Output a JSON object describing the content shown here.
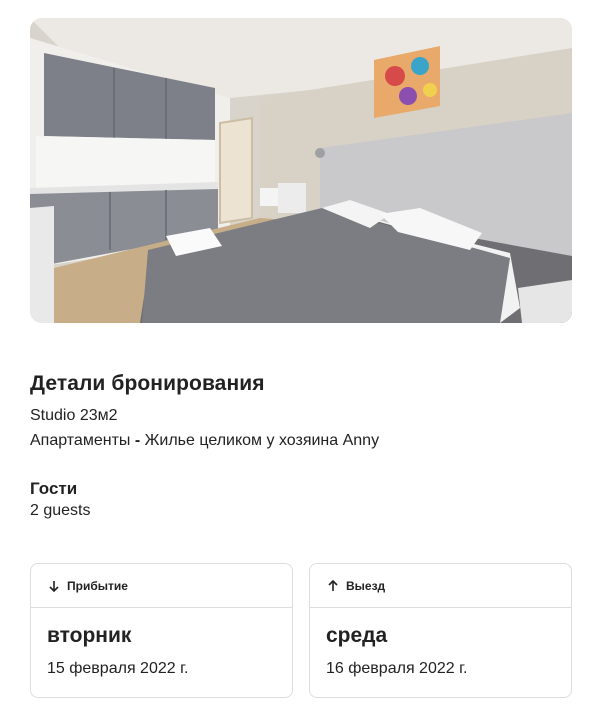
{
  "listing": {
    "photo_icon": "bedroom-photo"
  },
  "booking": {
    "title": "Детали бронирования",
    "room_name": "Studio 23м2",
    "property_type": "Апартаменты",
    "separator": "-",
    "listing_description": "Жилье целиком у хозяина Anny"
  },
  "guests": {
    "heading": "Гости",
    "value": "2 guests"
  },
  "checkin": {
    "icon": "arrow-down-icon",
    "label": "Прибытие",
    "weekday": "вторник",
    "date": "15 февраля 2022 г."
  },
  "checkout": {
    "icon": "arrow-up-icon",
    "label": "Выезд",
    "weekday": "среда",
    "date": "16 февраля 2022 г."
  }
}
